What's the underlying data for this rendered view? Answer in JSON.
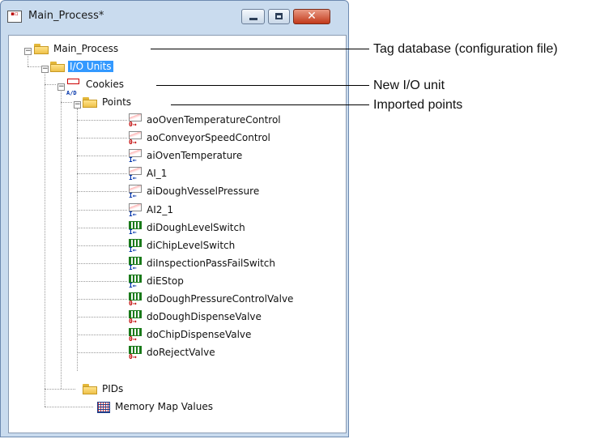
{
  "window": {
    "title": "Main_Process*",
    "controls": {
      "minimize": "minimize",
      "maximize": "maximize",
      "close": "✕"
    }
  },
  "tree": {
    "root": "Main_Process",
    "io_units": "I/O Units",
    "unit": "Cookies",
    "points_folder": "Points",
    "points": [
      {
        "label": "aoOvenTemperatureControl",
        "kind": "analog-out"
      },
      {
        "label": "aoConveyorSpeedControl",
        "kind": "analog-out"
      },
      {
        "label": "aiOvenTemperature",
        "kind": "analog-in"
      },
      {
        "label": "AI_1",
        "kind": "analog-in"
      },
      {
        "label": "aiDoughVesselPressure",
        "kind": "analog-in"
      },
      {
        "label": "AI2_1",
        "kind": "analog-in"
      },
      {
        "label": "diDoughLevelSwitch",
        "kind": "digital-in"
      },
      {
        "label": "diChipLevelSwitch",
        "kind": "digital-in"
      },
      {
        "label": "diInspectionPassFailSwitch",
        "kind": "digital-in"
      },
      {
        "label": "diEStop",
        "kind": "digital-in"
      },
      {
        "label": "doDoughPressureControlValve",
        "kind": "digital-out"
      },
      {
        "label": "doDoughDispenseValve",
        "kind": "digital-out"
      },
      {
        "label": "doChipDispenseValve",
        "kind": "digital-out"
      },
      {
        "label": "doRejectValve",
        "kind": "digital-out"
      }
    ],
    "pids": "PIDs",
    "memory_map": "Memory Map Values"
  },
  "callouts": {
    "database": "Tag database (configuration file)",
    "new_unit": "New I/O unit",
    "imported": "Imported points"
  },
  "icon_glyphs": {
    "out": "0→",
    "in": "I←",
    "ad": "A/D",
    "expander_minus": "−"
  },
  "colors": {
    "selection": "#3399ff",
    "window_frame": "#c9dbee",
    "close_button": "#c2391a"
  }
}
